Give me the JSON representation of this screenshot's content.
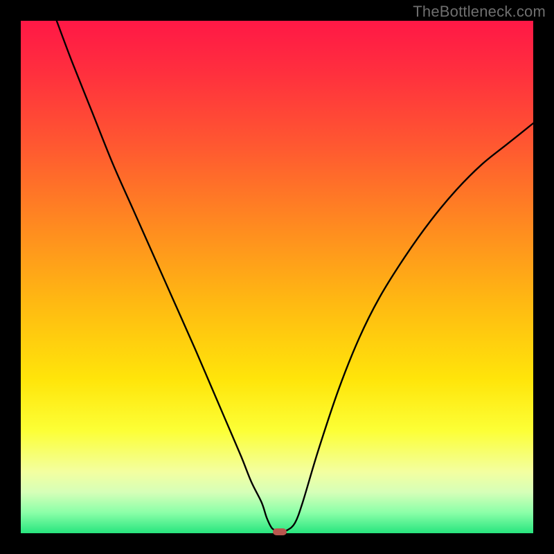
{
  "watermark": "TheBottleneck.com",
  "chart_data": {
    "type": "line",
    "title": "",
    "xlabel": "",
    "ylabel": "",
    "xlim": [
      0,
      100
    ],
    "ylim": [
      0,
      100
    ],
    "grid": false,
    "legend": false,
    "series": [
      {
        "name": "curve",
        "x": [
          7,
          10,
          14,
          18,
          22,
          26,
          30,
          34,
          37,
          40,
          43,
          45,
          47,
          48,
          49,
          50,
          51,
          52,
          53.5,
          55,
          58,
          62,
          66,
          70,
          75,
          80,
          85,
          90,
          95,
          100
        ],
        "y": [
          100,
          92,
          82,
          72,
          63,
          54,
          45,
          36,
          29,
          22,
          15,
          10,
          6,
          3,
          1,
          0.5,
          0.5,
          0.6,
          2,
          6,
          16,
          28,
          38,
          46,
          54,
          61,
          67,
          72,
          76,
          80
        ]
      }
    ],
    "marker": {
      "x": 50.5,
      "y": 0.3,
      "color": "#b9564e"
    },
    "background_gradient": {
      "top": "#ff1846",
      "mid": "#ffe50a",
      "bottom": "#27e57e"
    }
  }
}
